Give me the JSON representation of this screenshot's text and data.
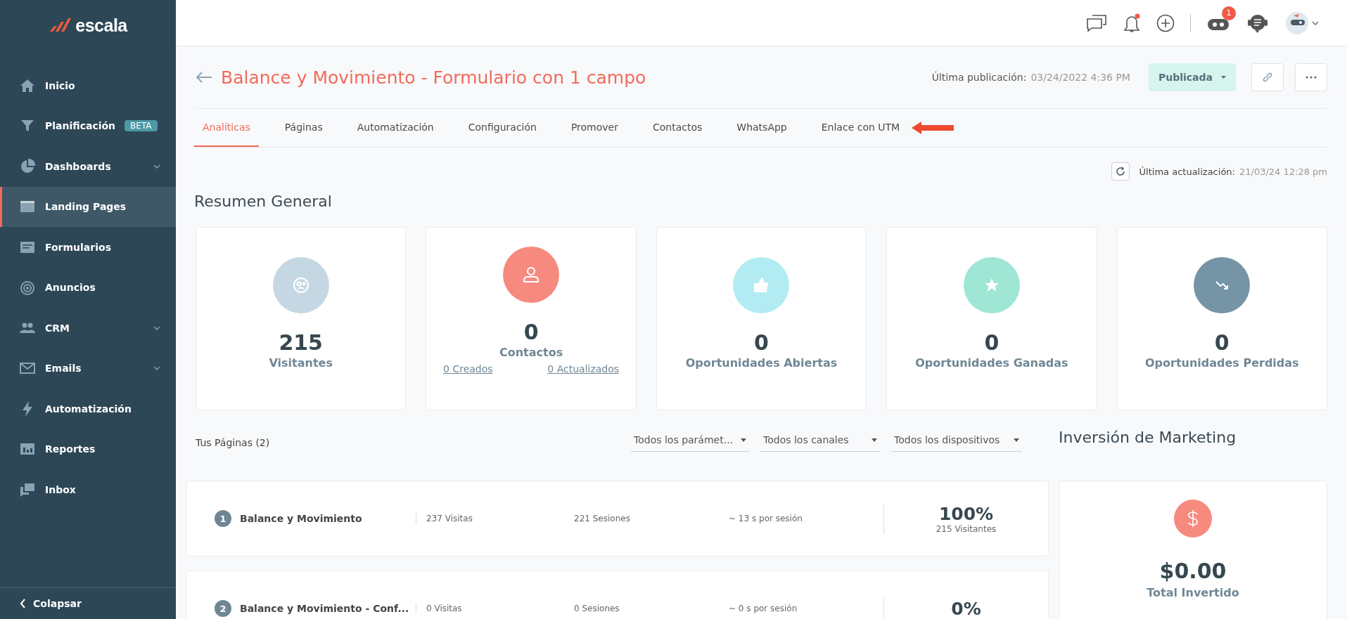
{
  "sidebar": {
    "logo": "escala",
    "items": [
      {
        "label": "Inicio",
        "selected": false,
        "has_submenu": false
      },
      {
        "label": "Planificación",
        "selected": false,
        "has_submenu": false,
        "badge": "BETA"
      },
      {
        "label": "Dashboards",
        "selected": false,
        "has_submenu": true
      },
      {
        "label": "Landing Pages",
        "selected": true,
        "has_submenu": false
      },
      {
        "label": "Formularios",
        "selected": false,
        "has_submenu": false
      },
      {
        "label": "Anuncios",
        "selected": false,
        "has_submenu": false
      },
      {
        "label": "CRM",
        "selected": false,
        "has_submenu": true
      },
      {
        "label": "Emails",
        "selected": false,
        "has_submenu": true
      },
      {
        "label": "Automatización",
        "selected": false,
        "has_submenu": false
      },
      {
        "label": "Reportes",
        "selected": false,
        "has_submenu": false
      },
      {
        "label": "Inbox",
        "selected": false,
        "has_submenu": false
      }
    ],
    "collapse": "Colapsar"
  },
  "topbar": {
    "notification_dot": true,
    "robot_badge": "1"
  },
  "header": {
    "title": "Balance y Movimiento - Formulario con 1 campo",
    "published_label": "Última publicación:",
    "published_date": "03/24/2022 4:36 PM",
    "status": "Publicada"
  },
  "tabs": [
    {
      "label": "Analíticas",
      "selected": true
    },
    {
      "label": "Páginas",
      "selected": false
    },
    {
      "label": "Automatización",
      "selected": false
    },
    {
      "label": "Configuración",
      "selected": false
    },
    {
      "label": "Promover",
      "selected": false
    },
    {
      "label": "Contactos",
      "selected": false
    },
    {
      "label": "WhatsApp",
      "selected": false
    },
    {
      "label": "Enlace con UTM",
      "selected": false
    }
  ],
  "update": {
    "label": "Última actualización:",
    "date": "21/03/24 12:28 pm"
  },
  "summary": {
    "title": "Resumen General",
    "cards": [
      {
        "value": "215",
        "label": "Visitantes",
        "color": "#c5d7e3"
      },
      {
        "value": "0",
        "label": "Contactos",
        "color": "#f68a7f",
        "links": [
          "0 Creados",
          "0 Actualizados"
        ]
      },
      {
        "value": "0",
        "label": "Oportunidades Abiertas",
        "color": "#b3ebf2"
      },
      {
        "value": "0",
        "label": "Oportunidades Ganadas",
        "color": "#9fe6d5"
      },
      {
        "value": "0",
        "label": "Oportunidades Perdidas",
        "color": "#7594a5"
      }
    ]
  },
  "pages": {
    "title": "Tus Páginas (2)",
    "filters": [
      "Todos los parámet...",
      "Todos los canales",
      "Todos los dispositivos"
    ],
    "rows": [
      {
        "number": "1",
        "name": "Balance y Movimiento",
        "visits": "237 Visitas",
        "sessions": "221 Sesiones",
        "duration": "~ 13 s por sesión",
        "percent": "100%",
        "visitors": "215 Visitantes"
      },
      {
        "number": "2",
        "name": "Balance y Movimiento - Conf...",
        "visits": "0 Visitas",
        "sessions": "0 Sesiones",
        "duration": "~ 0 s por sesión",
        "percent": "0%"
      }
    ]
  },
  "marketing": {
    "title": "Inversión de Marketing",
    "value": "$0.00",
    "label": "Total Invertido"
  }
}
